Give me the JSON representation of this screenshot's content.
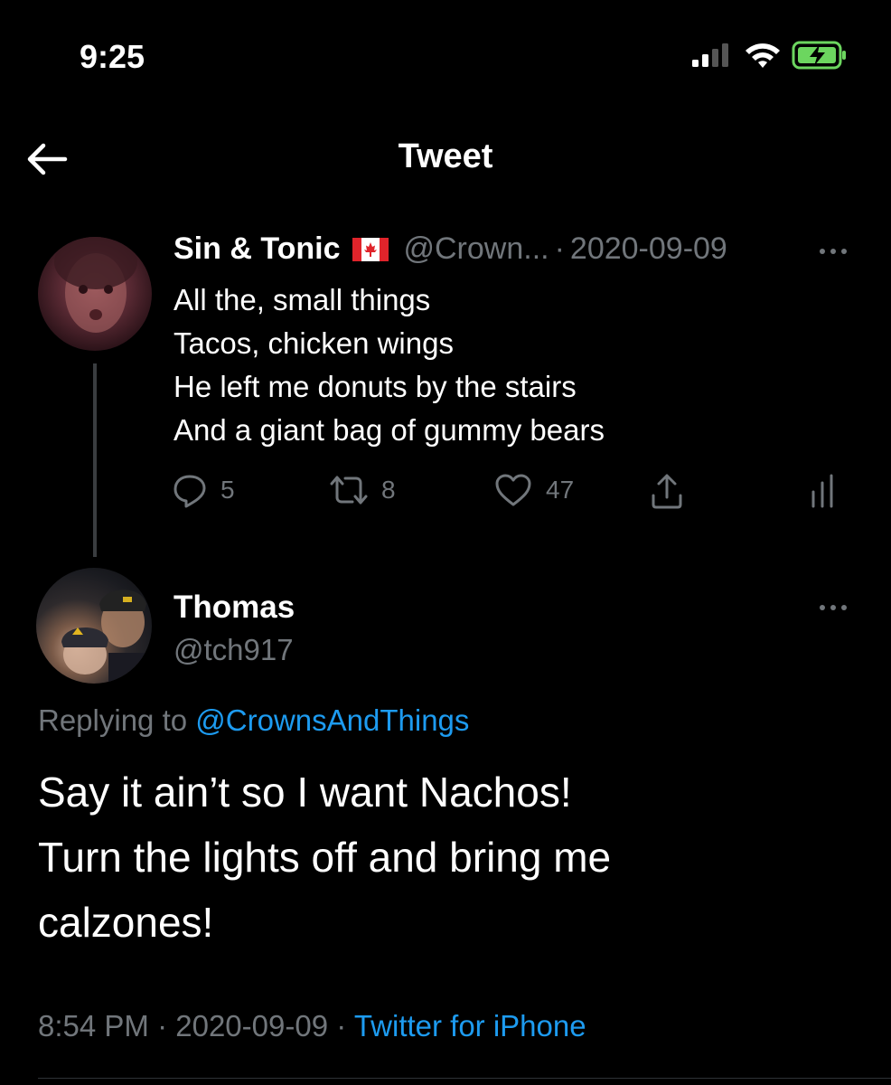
{
  "status_bar": {
    "time": "9:25",
    "battery_color": "#6cd65f"
  },
  "header": {
    "title": "Tweet",
    "back_icon": "arrow-left-icon"
  },
  "parent_tweet": {
    "display_name": "Sin & Tonic",
    "flag": "canada-flag",
    "handle": "@Crown...",
    "separator": "·",
    "date": "2020-09-09",
    "text_lines": [
      "All the, small things",
      "Tacos, chicken wings",
      "He left me donuts by the stairs",
      "And a giant bag of gummy bears"
    ],
    "actions": {
      "replies": "5",
      "retweets": "8",
      "likes": "47"
    }
  },
  "reply_tweet": {
    "display_name": "Thomas",
    "handle": "@tch917",
    "replying_prefix": "Replying to",
    "replying_to": "@CrownsAndThings",
    "text_lines": [
      "Say it ain’t so I want Nachos!",
      "Turn the lights off and bring me",
      "calzones!"
    ],
    "time": "8:54 PM",
    "separator": "·",
    "date": "2020-09-09",
    "source": "Twitter for iPhone"
  },
  "colors": {
    "background": "#000000",
    "link": "#1d9bf0",
    "muted": "#71767b"
  }
}
